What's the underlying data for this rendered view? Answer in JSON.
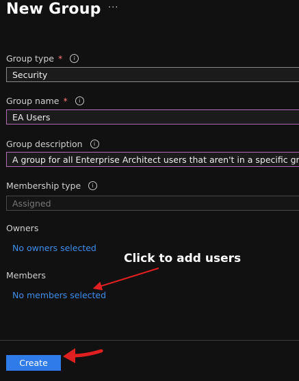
{
  "header": {
    "title": "New Group",
    "more_label": "···"
  },
  "form": {
    "group_type": {
      "label": "Group type",
      "required_mark": "*",
      "value": "Security"
    },
    "group_name": {
      "label": "Group name",
      "required_mark": "*",
      "value": "EA Users"
    },
    "group_description": {
      "label": "Group description",
      "value": "A group for all Enterprise Architect users that aren't in a specific group"
    },
    "membership_type": {
      "label": "Membership type",
      "value": "Assigned"
    },
    "owners": {
      "label": "Owners",
      "link": "No owners selected"
    },
    "members": {
      "label": "Members",
      "link": "No members selected"
    }
  },
  "footer": {
    "create_label": "Create"
  },
  "annotation": {
    "text": "Click to add users",
    "arrow_color": "#e02020"
  },
  "colors": {
    "link": "#3b8eea",
    "accent": "#2f7be8",
    "required": "#ff7a7a",
    "focus_border": "#b06fb6"
  },
  "icons": {
    "info": "info-icon"
  }
}
